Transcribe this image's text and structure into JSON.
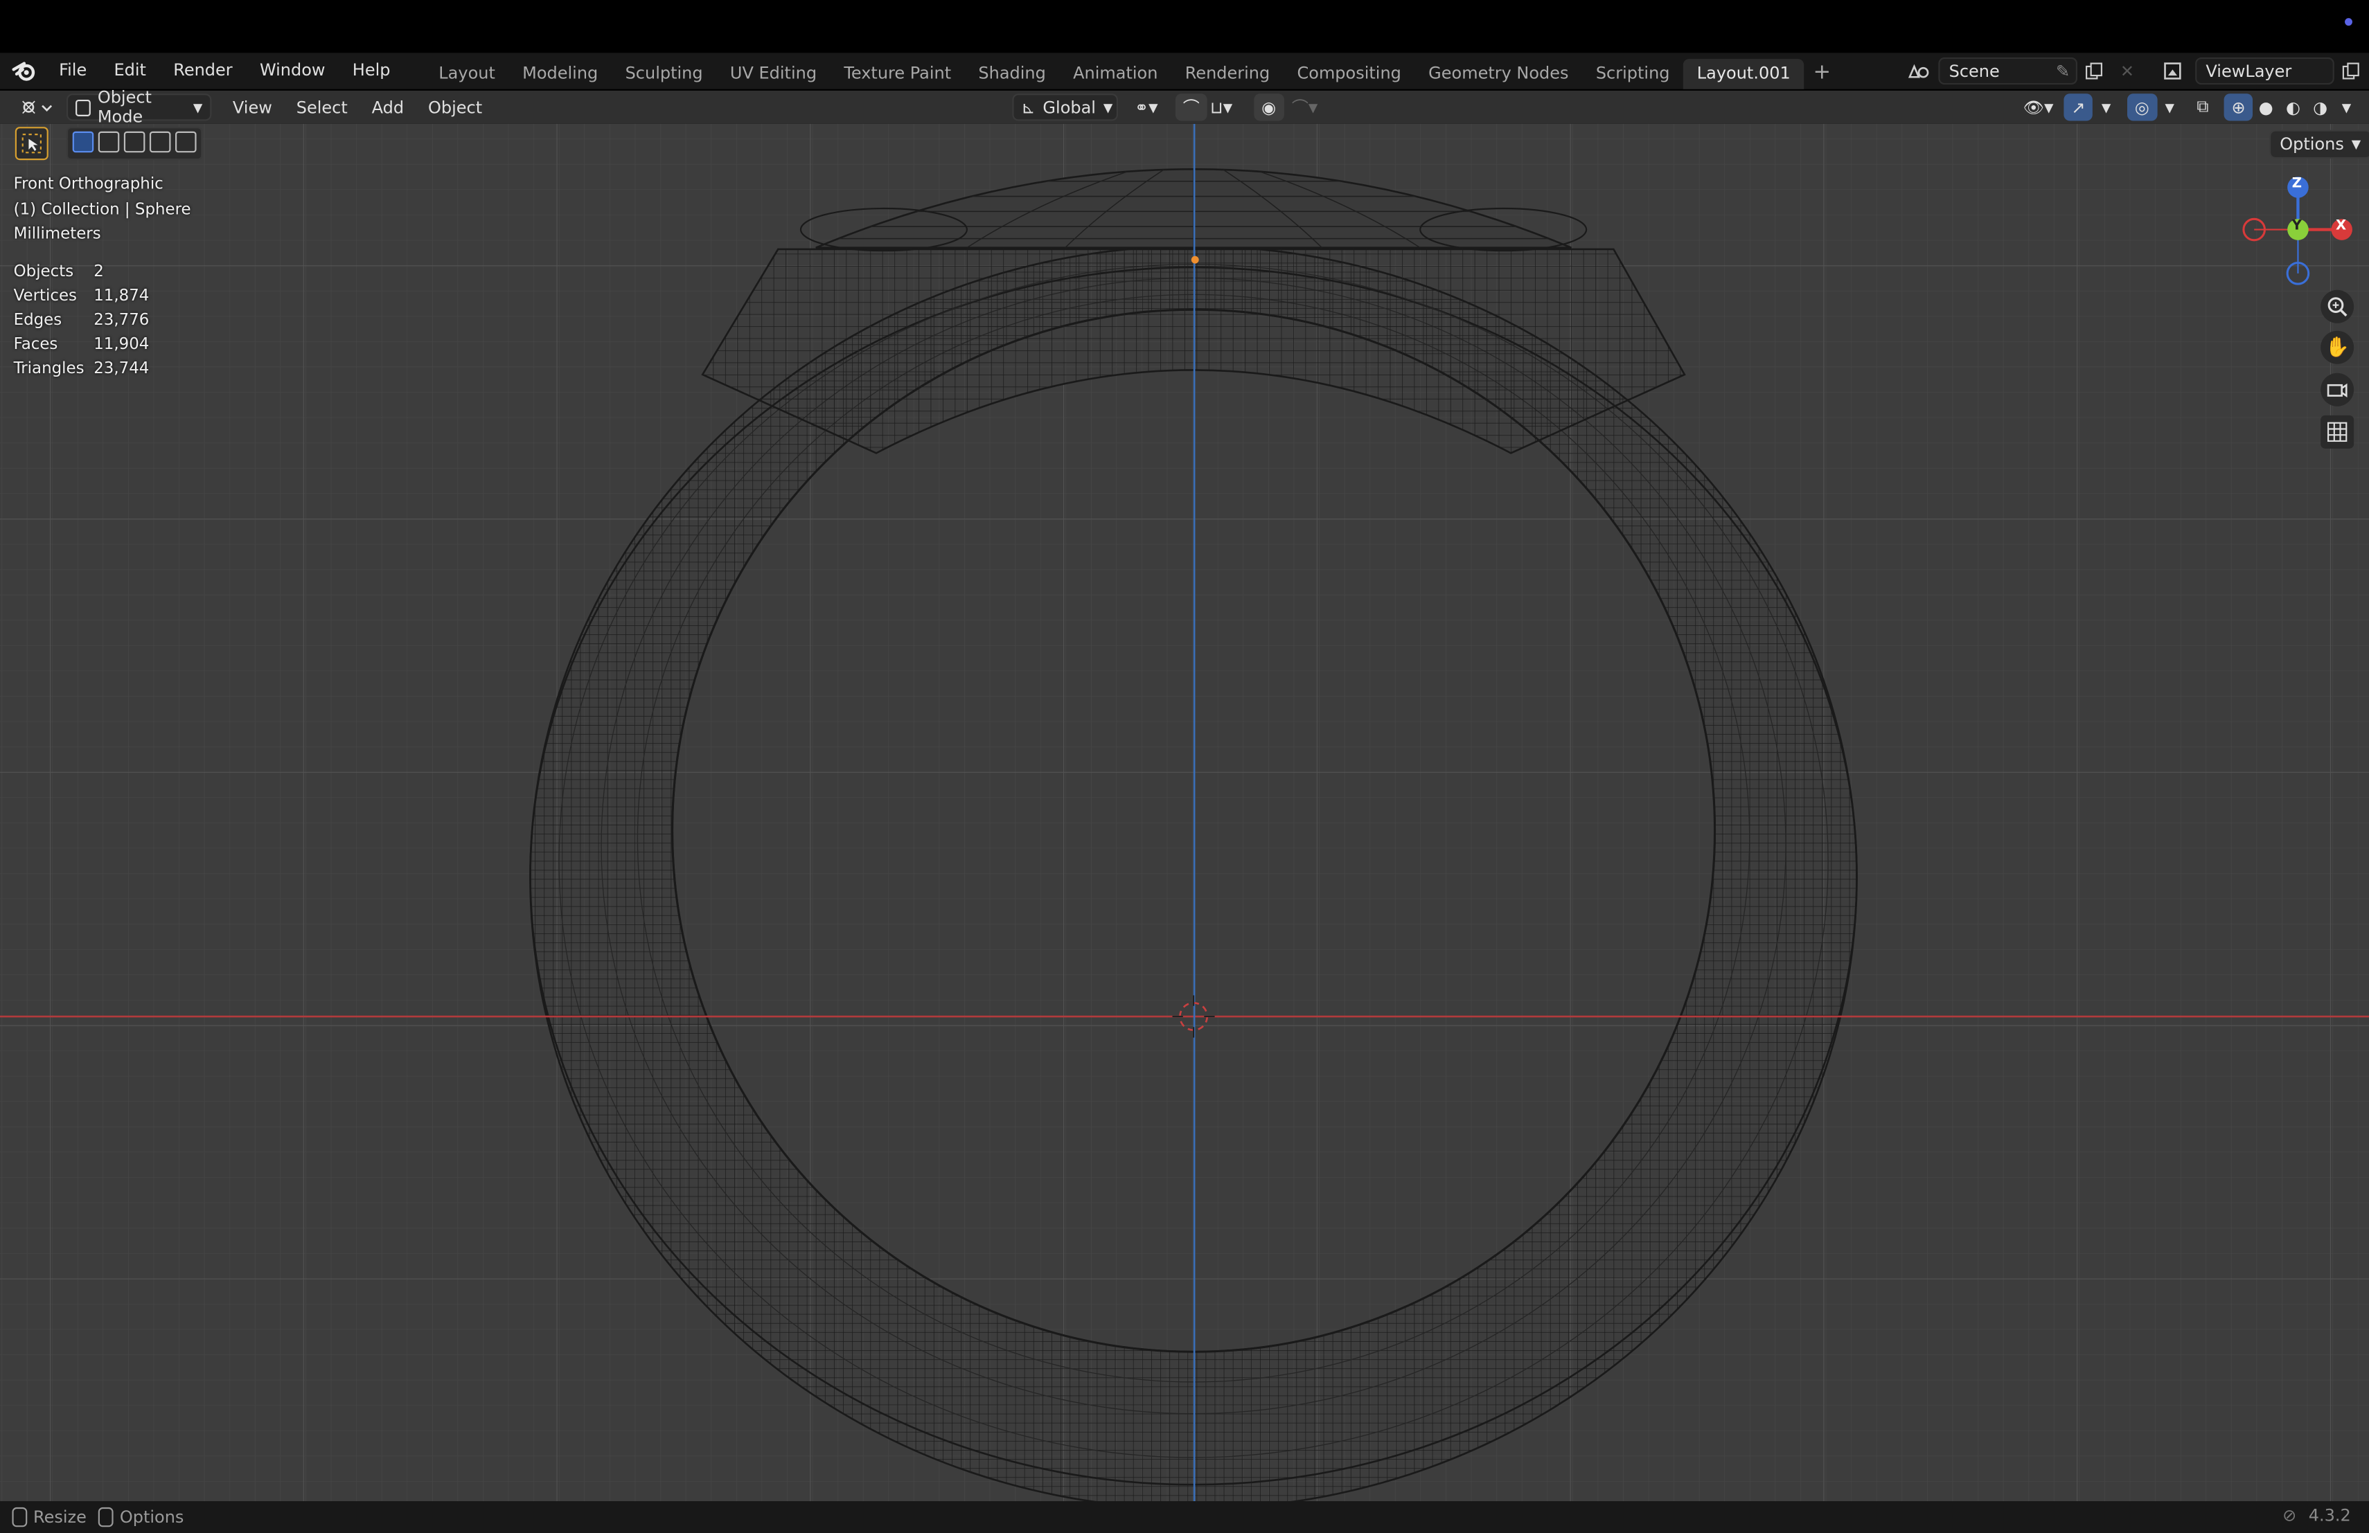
{
  "app": {
    "name": "Blender",
    "version": "4.3.2"
  },
  "menu": [
    "File",
    "Edit",
    "Render",
    "Window",
    "Help"
  ],
  "workspaces": [
    {
      "label": "Layout",
      "active": false
    },
    {
      "label": "Modeling",
      "active": false
    },
    {
      "label": "Sculpting",
      "active": false
    },
    {
      "label": "UV Editing",
      "active": false
    },
    {
      "label": "Texture Paint",
      "active": false
    },
    {
      "label": "Shading",
      "active": false
    },
    {
      "label": "Animation",
      "active": false
    },
    {
      "label": "Rendering",
      "active": false
    },
    {
      "label": "Compositing",
      "active": false
    },
    {
      "label": "Geometry Nodes",
      "active": false
    },
    {
      "label": "Scripting",
      "active": false
    },
    {
      "label": "Layout.001",
      "active": true
    }
  ],
  "add_tab": "+",
  "scene": {
    "name": "Scene"
  },
  "view_layer": {
    "name": "ViewLayer"
  },
  "header": {
    "mode": "Object Mode",
    "menus": [
      "View",
      "Select",
      "Add",
      "Object"
    ],
    "transform_orientation": "Global",
    "options_label": "Options"
  },
  "viewport": {
    "view_name": "Front Orthographic",
    "collection_line": "(1) Collection | Sphere",
    "units": "Millimeters",
    "stats": [
      {
        "key": "Objects",
        "value": "2"
      },
      {
        "key": "Vertices",
        "value": "11,874"
      },
      {
        "key": "Edges",
        "value": "23,776"
      },
      {
        "key": "Faces",
        "value": "11,904"
      },
      {
        "key": "Triangles",
        "value": "23,744"
      }
    ],
    "gizmo": {
      "z": "Z",
      "y": "Y",
      "x": "X"
    },
    "colors": {
      "bg": "#3d3d3d",
      "x_axis": "#c0393b",
      "z_axis": "#3a6fb8",
      "mesh": "#1e1e1e"
    }
  },
  "statusbar": {
    "left": [
      {
        "icon": "mouse-icon",
        "label": "Resize"
      },
      {
        "icon": "mouse-icon",
        "label": "Options"
      }
    ],
    "version": "4.3.2"
  }
}
